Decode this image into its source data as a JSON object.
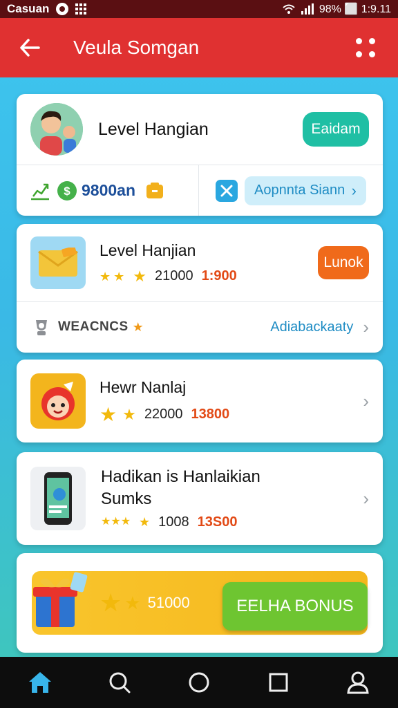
{
  "status_bar": {
    "carrier": "Casuan",
    "right_text": "98% ⬜ 1:9.11"
  },
  "app_bar": {
    "title": "Veula Somgan"
  },
  "card1": {
    "title": "Level Hangian",
    "button": "Eaidam",
    "amount": "9800an",
    "link_button": "Aopnnta Siann"
  },
  "card2": {
    "title": "Level Hanjian",
    "score": "21000",
    "score_red": "1:900",
    "button": "Lunok",
    "footer_label": "WEACNCS",
    "footer_link": "Adiabackaaty"
  },
  "card3": {
    "title": "Hewr Nanlaj",
    "score": "22000",
    "score_red": "13800"
  },
  "card4": {
    "title_line1": "Hadikan is Hanlaikian",
    "title_line2": "Sumks",
    "score": "1008",
    "score_red": "13S00"
  },
  "card5": {
    "score": "51000",
    "button": "EELHA BONUS"
  },
  "colors": {
    "appbar": "#e03131",
    "teal_button": "#1fbfa4",
    "orange_button": "#f06a1a",
    "green_button": "#6ec531",
    "star": "#f2b90c"
  },
  "icons": {
    "back": "arrow-left-icon",
    "more": "more-dots-icon",
    "nav": [
      "home-icon",
      "search-icon",
      "circle-icon",
      "square-icon",
      "profile-icon"
    ]
  }
}
